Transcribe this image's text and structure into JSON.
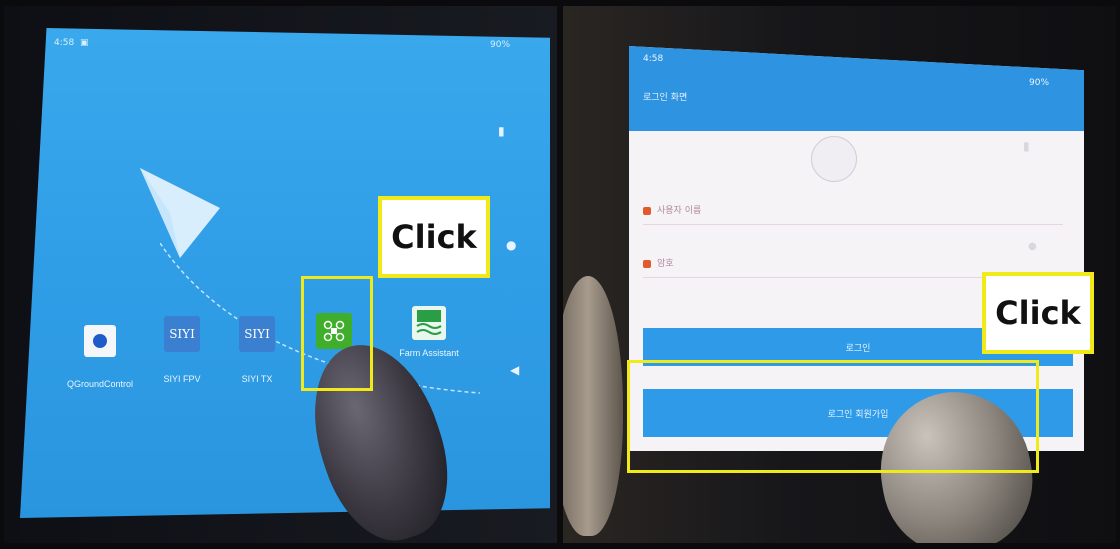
{
  "left_photo": {
    "status_time": "4:58",
    "status_right": "90%",
    "apps": [
      {
        "label": "QGroundControl",
        "icon": "qgc-icon"
      },
      {
        "label": "SIYI FPV",
        "icon": "siyi-fpv-icon"
      },
      {
        "label": "SIYI TX",
        "icon": "siyi-tx-icon"
      },
      {
        "label": "",
        "icon": "drone-app-icon"
      },
      {
        "label": "Farm Assistant",
        "icon": "farm-assistant-icon"
      }
    ],
    "siyi_text": "SIYI",
    "click_label": "Click"
  },
  "right_photo": {
    "status_time": "4:58",
    "status_right": "90%",
    "header_title": "로그인 화면",
    "field_user": "사용자 이름",
    "field_password": "암호",
    "login_button": "로그인",
    "register_button": "로그인 회원가입",
    "click_label": "Click"
  },
  "colors": {
    "screen_blue": "#2f9de6",
    "highlight_yellow": "#f0ea1b",
    "drone_green": "#3fae2a"
  }
}
